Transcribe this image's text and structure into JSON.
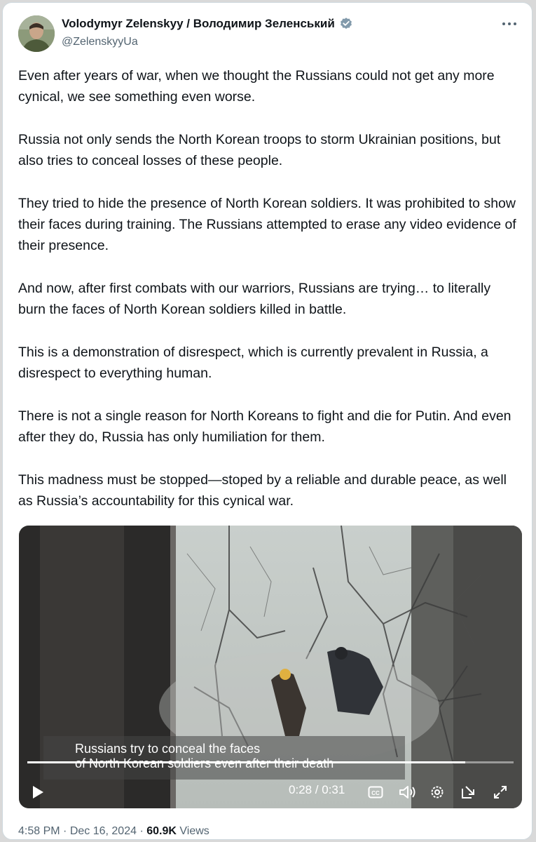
{
  "author": {
    "display_name": "Volodymyr Zelenskyy / Володимир Зеленський",
    "handle": "@ZelenskyyUa",
    "verified_icon": "verified-badge-icon",
    "badge_color": "#829aab"
  },
  "tweet": {
    "paragraphs": [
      "Even after years of war, when we thought the Russians could not get any more cynical, we see something even worse.",
      "Russia not only sends the North Korean troops to storm Ukrainian positions, but also tries to conceal losses of these people.",
      "They tried to hide the presence of North Korean soldiers. It was prohibited to show their faces during training. The Russians attempted to erase any video evidence of their presence.",
      "And now, after first combats with our warriors, Russians are trying… to literally burn the faces of North Korean soldiers killed in battle.",
      "This is a demonstration of disrespect, which is currently prevalent in Russia, a disrespect to everything human.",
      "There is not a single reason for North Koreans to fight and die for Putin. And even after they do, Russia has only humiliation for them.",
      "This madness must be stopped—stoped by a reliable and durable peace, as well as Russia’s accountability for this cynical war."
    ]
  },
  "video": {
    "caption_line1": "Russians try to conceal the faces",
    "caption_line2": "of North Korean soldiers even after their death",
    "time": "0:28 / 0:31",
    "progress": 0.9,
    "icons": [
      "play-icon",
      "cc-icon",
      "volume-icon",
      "settings-icon",
      "popout-icon",
      "fullscreen-icon"
    ]
  },
  "meta": {
    "time": "4:58 PM",
    "separator": " · ",
    "date": "Dec 16, 2024",
    "views_count": "60.9K",
    "views_label": "Views"
  }
}
